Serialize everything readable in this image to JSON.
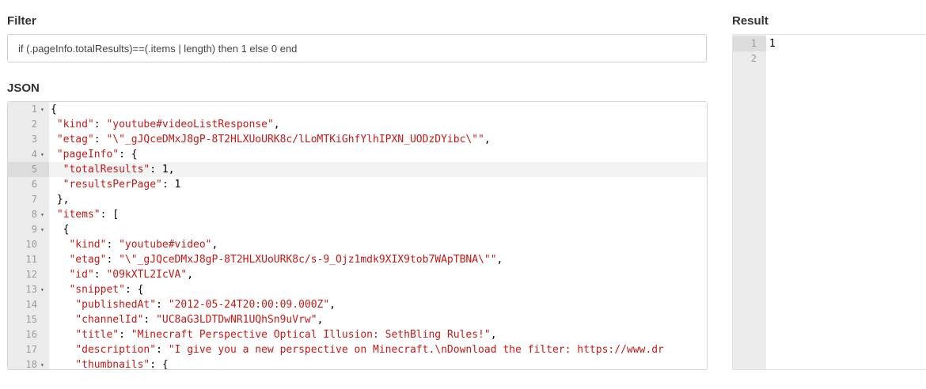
{
  "filter": {
    "title": "Filter",
    "value": "if (.pageInfo.totalResults)==(.items | length) then 1 else 0 end"
  },
  "json_panel": {
    "title": "JSON",
    "lines": [
      {
        "num": "1",
        "fold": true,
        "text": "{"
      },
      {
        "num": "2",
        "fold": false,
        "text": " \"kind\": \"youtube#videoListResponse\","
      },
      {
        "num": "3",
        "fold": false,
        "text": " \"etag\": \"\\\"_gJQceDMxJ8gP-8T2HLXUoURK8c/lLoMTKiGhfYlhIPXN_UODzDYibc\\\"\","
      },
      {
        "num": "4",
        "fold": true,
        "text": " \"pageInfo\": {"
      },
      {
        "num": "5",
        "fold": false,
        "text": "  \"totalResults\": 1,",
        "active": true
      },
      {
        "num": "6",
        "fold": false,
        "text": "  \"resultsPerPage\": 1"
      },
      {
        "num": "7",
        "fold": false,
        "text": " },"
      },
      {
        "num": "8",
        "fold": true,
        "text": " \"items\": ["
      },
      {
        "num": "9",
        "fold": true,
        "text": "  {"
      },
      {
        "num": "10",
        "fold": false,
        "text": "   \"kind\": \"youtube#video\","
      },
      {
        "num": "11",
        "fold": false,
        "text": "   \"etag\": \"\\\"_gJQceDMxJ8gP-8T2HLXUoURK8c/s-9_Ojz1mdk9XIX9tob7WApTBNA\\\"\","
      },
      {
        "num": "12",
        "fold": false,
        "text": "   \"id\": \"09kXTL2IcVA\","
      },
      {
        "num": "13",
        "fold": true,
        "text": "   \"snippet\": {"
      },
      {
        "num": "14",
        "fold": false,
        "text": "    \"publishedAt\": \"2012-05-24T20:00:09.000Z\","
      },
      {
        "num": "15",
        "fold": false,
        "text": "    \"channelId\": \"UC8aG3LDTDwNR1UQhSn9uVrw\","
      },
      {
        "num": "16",
        "fold": false,
        "text": "    \"title\": \"Minecraft Perspective Optical Illusion: SethBling Rules!\","
      },
      {
        "num": "17",
        "fold": false,
        "text": "    \"description\": \"I give you a new perspective on Minecraft.\\nDownload the filter: https://www.dr"
      },
      {
        "num": "18",
        "fold": true,
        "text": "    \"thumbnails\": {"
      }
    ]
  },
  "result": {
    "title": "Result",
    "lines": [
      {
        "num": "1",
        "text": "1",
        "active": true
      },
      {
        "num": "2",
        "text": ""
      }
    ]
  },
  "colors": {
    "string": "#c41a16",
    "gutter": "#ebebeb",
    "active_gutter": "#dcdcdc"
  },
  "icons": {
    "fold": "fold-arrow-icon"
  }
}
